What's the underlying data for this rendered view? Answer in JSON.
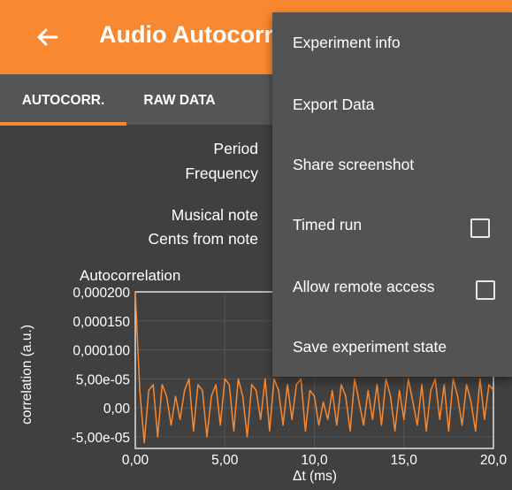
{
  "appbar": {
    "title": "Audio Autocorr",
    "back_icon": "arrow-left-icon"
  },
  "tabs": [
    {
      "label": "AUTOCORR.",
      "active": true
    },
    {
      "label": "RAW DATA",
      "active": false
    }
  ],
  "info": {
    "period_label": "Period",
    "frequency_label": "Frequency",
    "musical_note_label": "Musical note",
    "cents_label": "Cents from note"
  },
  "colors": {
    "accent": "#f98930",
    "background": "#404040",
    "menu": "#535353"
  },
  "menu": {
    "items": [
      {
        "label": "Experiment info"
      },
      {
        "label": "Export Data"
      },
      {
        "label": "Share screenshot"
      },
      {
        "label": "Timed run",
        "checkbox": true,
        "checked": false
      },
      {
        "label": "Allow remote access",
        "checkbox": true,
        "checked": false
      },
      {
        "label": "Save experiment state"
      }
    ]
  },
  "chart_data": {
    "type": "line",
    "title": "Autocorrelation",
    "xlabel": "Δt (ms)",
    "ylabel": "correlation (a.u.)",
    "xlim": [
      0,
      20
    ],
    "ylim": [
      -7e-05,
      0.0002
    ],
    "x_ticks": [
      "0,00",
      "5,00",
      "10,0",
      "15,0",
      "20,0"
    ],
    "y_ticks": [
      "0,000200",
      "0,000150",
      "0,000100",
      "5,00e-05",
      "0,00",
      "-5,00e-05"
    ],
    "y_tick_values": [
      0.0002,
      0.00015,
      0.0001,
      5e-05,
      0,
      -5e-05
    ],
    "series": [
      {
        "color": "#f98930",
        "x": [
          0,
          0.25,
          0.5,
          0.75,
          1,
          1.25,
          1.5,
          1.75,
          2,
          2.25,
          2.5,
          2.75,
          3,
          3.25,
          3.5,
          3.75,
          4,
          4.25,
          4.5,
          4.75,
          5,
          5.25,
          5.5,
          5.75,
          6,
          6.25,
          6.5,
          6.75,
          7,
          7.25,
          7.5,
          7.75,
          8,
          8.25,
          8.5,
          8.75,
          9,
          9.25,
          9.5,
          9.75,
          10,
          10.25,
          10.5,
          10.75,
          11,
          11.25,
          11.5,
          11.75,
          12,
          12.25,
          12.5,
          12.75,
          13,
          13.25,
          13.5,
          13.75,
          14,
          14.25,
          14.5,
          14.75,
          15,
          15.25,
          15.5,
          15.75,
          16,
          16.25,
          16.5,
          16.75,
          17,
          17.25,
          17.5,
          17.75,
          18,
          18.25,
          18.5,
          18.75,
          19,
          19.25,
          19.5,
          19.75,
          20
        ],
        "y": [
          0.0002,
          3e-05,
          -6e-05,
          3e-05,
          4e-05,
          -5e-05,
          4e-05,
          2e-05,
          -3e-05,
          2e-05,
          -2e-05,
          3e-05,
          5e-05,
          -4e-05,
          4e-05,
          3e-05,
          -5e-05,
          2e-05,
          4e-05,
          -3e-05,
          5e-05,
          4e-05,
          -4e-05,
          5e-05,
          2e-05,
          -5e-05,
          4e-05,
          3e-05,
          -2e-05,
          5e-05,
          -4e-05,
          5e-05,
          3e-05,
          -3e-05,
          4e-05,
          -2e-05,
          4e-05,
          5e-05,
          -4e-05,
          3e-05,
          2e-05,
          -3e-05,
          1e-05,
          -2e-05,
          3e-05,
          -3e-05,
          4e-05,
          2e-05,
          -4e-05,
          5e-05,
          1e-05,
          -3e-05,
          3e-05,
          -2e-05,
          4e-05,
          -3e-05,
          5e-05,
          2e-05,
          -4e-05,
          3e-05,
          -2e-05,
          5e-05,
          1e-05,
          -3e-05,
          4e-05,
          -4e-05,
          3e-05,
          5e-05,
          -2e-05,
          4e-05,
          -4e-05,
          5e-05,
          2e-05,
          -3e-05,
          4e-05,
          1e-05,
          -4e-05,
          5e-05,
          -2e-05,
          4e-05,
          3e-05
        ]
      }
    ]
  }
}
